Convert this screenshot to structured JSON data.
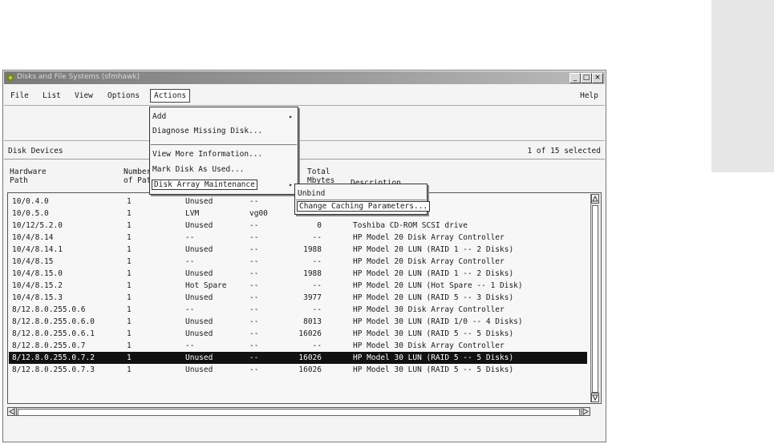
{
  "window": {
    "title": "Disks and File Systems (sfmhawk)"
  },
  "title_buttons": {
    "minimize": "_",
    "maximize": "□",
    "close": "×"
  },
  "menubar": {
    "file": "File",
    "list": "List",
    "view": "View",
    "options": "Options",
    "actions": "Actions",
    "help": "Help"
  },
  "section": {
    "label": "Disk Devices",
    "selected_count": "1 of 15 selected"
  },
  "columns": {
    "hardware_path": "Hardware\nPath",
    "number_of_paths": "Number\nof Paths",
    "total_mbytes": "Total\nMbytes",
    "description": "Description"
  },
  "actions_menu": {
    "add": "Add",
    "diagnose": "Diagnose Missing Disk...",
    "view_more": "View More Information...",
    "mark_used": "Mark Disk As Used...",
    "array_maintenance": "Disk Array Maintenance"
  },
  "submenu": {
    "unbind": "Unbind",
    "change_caching": "Change Caching Parameters..."
  },
  "rows": [
    {
      "path": "10/0.4.0",
      "paths": "1",
      "use": "Unused",
      "group": "--",
      "mbytes": "",
      "desc": "CSI Disk Drive"
    },
    {
      "path": "10/0.5.0",
      "paths": "1",
      "use": "LVM",
      "group": "vg00",
      "mbytes": "",
      "desc": ""
    },
    {
      "path": "10/12/5.2.0",
      "paths": "1",
      "use": "Unused",
      "group": "--",
      "mbytes": "0",
      "desc": "Toshiba CD-ROM SCSI drive"
    },
    {
      "path": "10/4/8.14",
      "paths": "1",
      "use": "--",
      "group": "--",
      "mbytes": "--",
      "desc": "HP Model 20 Disk Array Controller"
    },
    {
      "path": "10/4/8.14.1",
      "paths": "1",
      "use": "Unused",
      "group": "--",
      "mbytes": "1988",
      "desc": "HP Model 20 LUN (RAID 1 -- 2 Disks)"
    },
    {
      "path": "10/4/8.15",
      "paths": "1",
      "use": "--",
      "group": "--",
      "mbytes": "--",
      "desc": "HP Model 20 Disk Array Controller"
    },
    {
      "path": "10/4/8.15.0",
      "paths": "1",
      "use": "Unused",
      "group": "--",
      "mbytes": "1988",
      "desc": "HP Model 20 LUN (RAID 1 -- 2 Disks)"
    },
    {
      "path": "10/4/8.15.2",
      "paths": "1",
      "use": "Hot Spare",
      "group": "--",
      "mbytes": "--",
      "desc": "HP Model 20 LUN (Hot Spare -- 1 Disk)"
    },
    {
      "path": "10/4/8.15.3",
      "paths": "1",
      "use": "Unused",
      "group": "--",
      "mbytes": "3977",
      "desc": "HP Model 20 LUN (RAID 5 -- 3 Disks)"
    },
    {
      "path": "8/12.8.0.255.0.6",
      "paths": "1",
      "use": "--",
      "group": "--",
      "mbytes": "--",
      "desc": "HP Model 30 Disk Array Controller"
    },
    {
      "path": "8/12.8.0.255.0.6.0",
      "paths": "1",
      "use": "Unused",
      "group": "--",
      "mbytes": "8013",
      "desc": "HP Model 30 LUN (RAID 1/0 -- 4 Disks)"
    },
    {
      "path": "8/12.8.0.255.0.6.1",
      "paths": "1",
      "use": "Unused",
      "group": "--",
      "mbytes": "16026",
      "desc": "HP Model 30 LUN (RAID 5 -- 5 Disks)"
    },
    {
      "path": "8/12.8.0.255.0.7",
      "paths": "1",
      "use": "--",
      "group": "--",
      "mbytes": "--",
      "desc": "HP Model 30 Disk Array Controller"
    },
    {
      "path": "8/12.8.0.255.0.7.2",
      "paths": "1",
      "use": "Unused",
      "group": "--",
      "mbytes": "16026",
      "desc": "HP Model 30 LUN (RAID 5 -- 5 Disks)",
      "selected": true
    },
    {
      "path": "8/12.8.0.255.0.7.3",
      "paths": "1",
      "use": "Unused",
      "group": "--",
      "mbytes": "16026",
      "desc": "HP Model 30 LUN (RAID 5 -- 5 Disks)"
    }
  ],
  "icons": {
    "app": "disk-manager-icon",
    "submenu": "chevron-right-icon",
    "scroll_up": "up-arrow-icon",
    "scroll_down": "down-arrow-icon",
    "scroll_left": "left-arrow-icon",
    "scroll_right": "right-arrow-icon"
  },
  "colors": {
    "selection_bg": "#111111",
    "selection_fg": "#ffffff"
  }
}
